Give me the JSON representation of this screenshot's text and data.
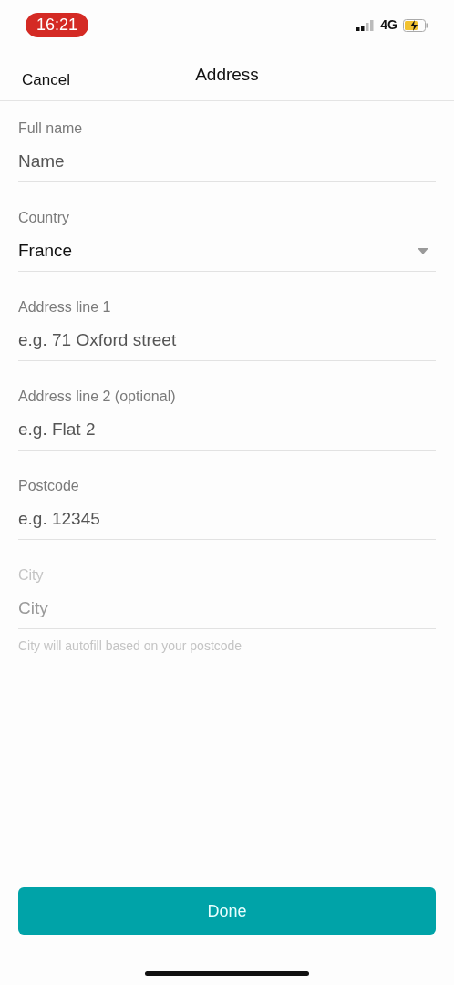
{
  "status_bar": {
    "time": "16:21",
    "network": "4G"
  },
  "nav": {
    "cancel": "Cancel",
    "title": "Address"
  },
  "fields": [
    {
      "kind": "text",
      "label": "Full name",
      "placeholder": "Name",
      "disabled": false
    },
    {
      "kind": "select",
      "label": "Country",
      "value": "France",
      "disabled": false
    },
    {
      "kind": "text",
      "label": "Address line 1",
      "placeholder": "e.g. 71 Oxford street",
      "disabled": false
    },
    {
      "kind": "text",
      "label": "Address line 2 (optional)",
      "placeholder": "e.g. Flat 2",
      "disabled": false
    },
    {
      "kind": "text",
      "label": "Postcode",
      "placeholder": "e.g. 12345",
      "disabled": false
    },
    {
      "kind": "text",
      "label": "City",
      "placeholder": "City",
      "disabled": true,
      "hint": "City will autofill based on your postcode"
    }
  ],
  "done": "Done"
}
